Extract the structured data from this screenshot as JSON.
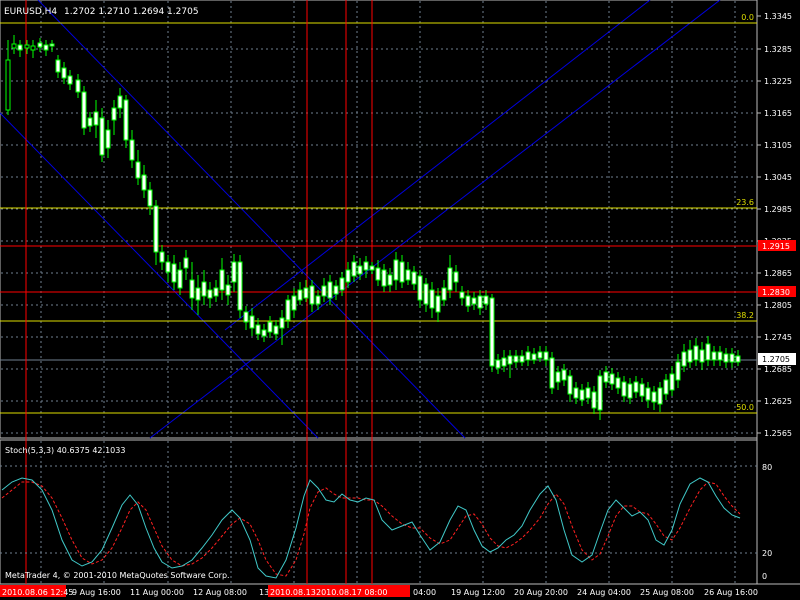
{
  "header": {
    "symbol_tf": "EURUSD,H4",
    "ohlc": "1.2702 1.2710 1.2694 1.2705"
  },
  "price_axis": {
    "ticks": [
      "1.3345",
      "1.3285",
      "1.3225",
      "1.3165",
      "1.3105",
      "1.3045",
      "1.2985",
      "1.2925",
      "1.2865",
      "1.2805",
      "1.2745",
      "1.2685",
      "1.2625",
      "1.2565"
    ],
    "current": "1.2705",
    "red_1": "1.2915",
    "red_2": "1.2830"
  },
  "fibo": {
    "l0": "0.0",
    "l236": "23.6",
    "l382": "38.2",
    "l500": "50.0"
  },
  "stoch": {
    "title": "Stoch(5,3,3) 40.6375 42.1033",
    "ticks": [
      "80",
      "20",
      "0"
    ]
  },
  "footer": {
    "copyright": "MetaTrader 4, © 2001-2010 MetaQuotes Software Corp.",
    "time_labels": [
      "9 Aug 16:00",
      "11 Aug 00:00",
      "12 Aug 08:00",
      "13",
      "19 Aug 12:00",
      "20 Aug 20:00",
      "24 Aug 04:00",
      "25 Aug 08:00",
      "26 Aug 16:00",
      "04:00"
    ],
    "red_times": [
      "2010.08.06 12:45",
      "2010.08.13",
      "2010.08.17 08:00",
      "2010.08.17 08:00"
    ]
  },
  "colors": {
    "grid": "#708090",
    "candle": "#00ff00",
    "blue": "#0000dd",
    "red": "#ff0000",
    "yellow": "#dede00",
    "k": "#40c8c8",
    "d": "#ff2020"
  }
}
